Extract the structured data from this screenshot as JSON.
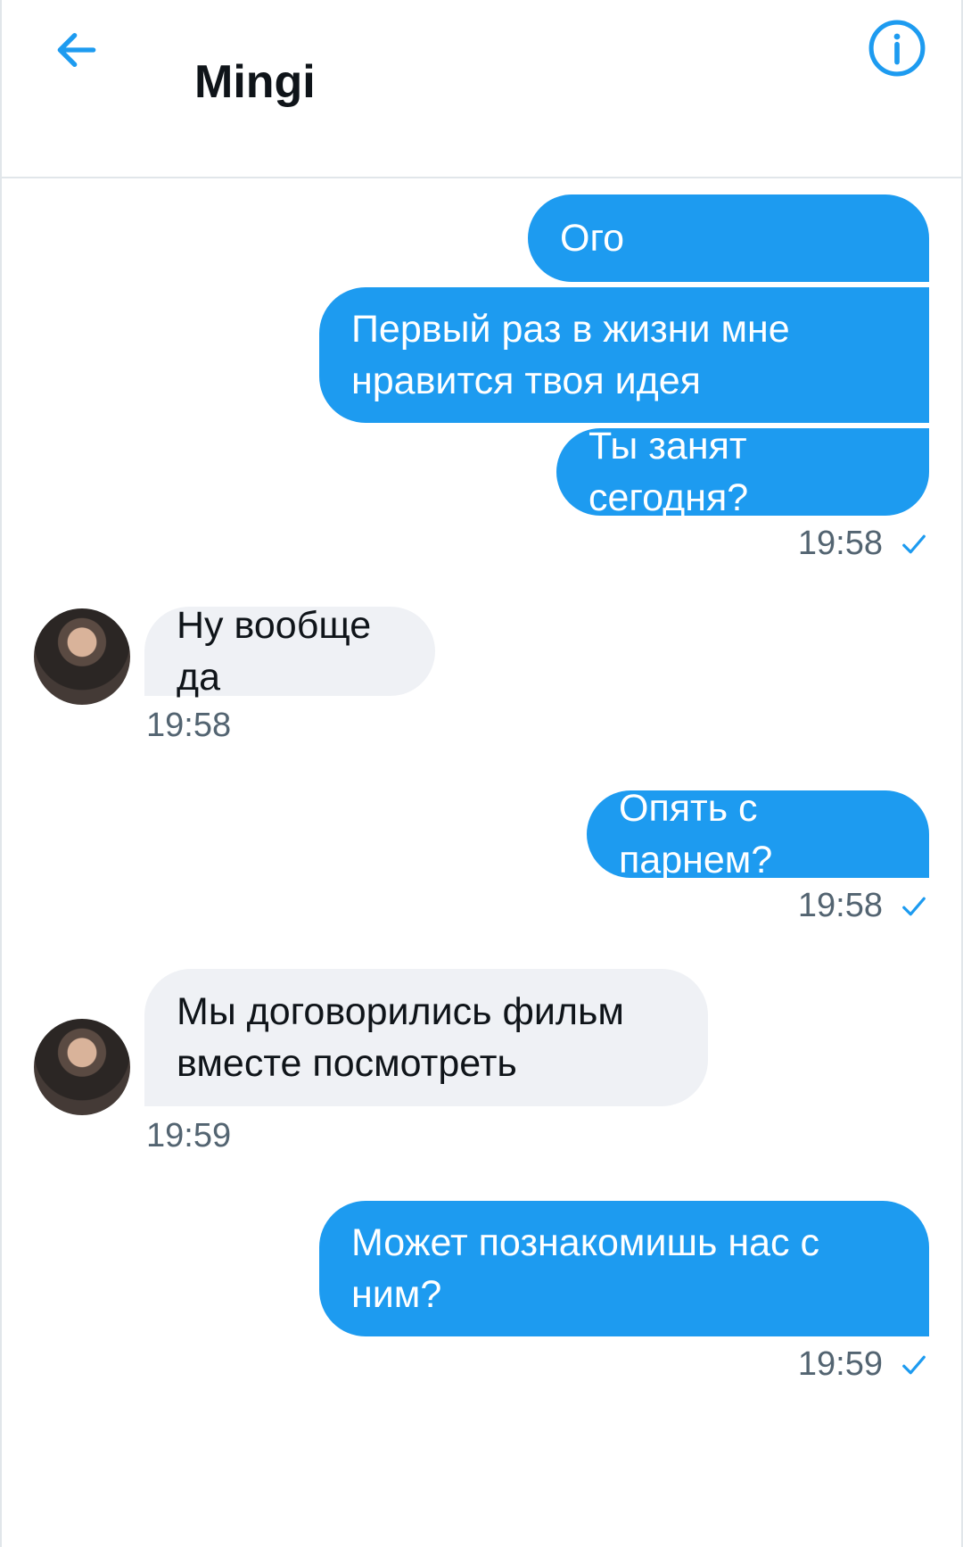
{
  "header": {
    "title": "Mingi"
  },
  "messages": [
    {
      "text": "Ого"
    },
    {
      "text": "Первый раз в жизни мне нравится твоя идея"
    },
    {
      "text": "Ты занят сегодня?"
    },
    {
      "time": "19:58"
    },
    {
      "text": "Ну вообще да"
    },
    {
      "time": "19:58"
    },
    {
      "text": "Опять с парнем?"
    },
    {
      "time": "19:58"
    },
    {
      "text": "Мы договорились фильм вместе посмотреть"
    },
    {
      "time": "19:59"
    },
    {
      "text": "Может познакомишь нас с ним?"
    },
    {
      "time": "19:59"
    }
  ],
  "colors": {
    "accent": "#1d9bf0",
    "incoming_bubble": "#eff1f5",
    "muted_text": "#536471"
  },
  "icons": {
    "back": "arrow-left-icon",
    "info": "info-circle-icon",
    "read_receipt": "check-icon"
  }
}
